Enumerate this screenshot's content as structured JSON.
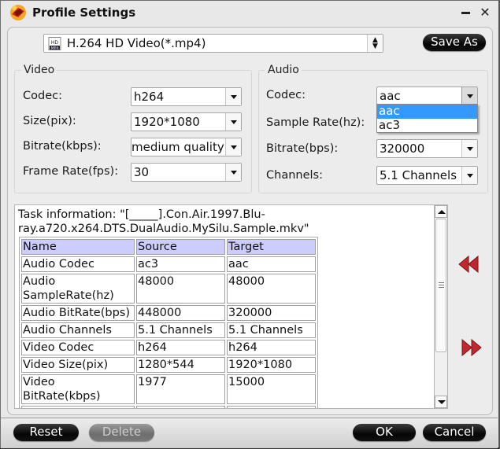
{
  "window": {
    "title": "Profile Settings",
    "minimize_icon": "minimize-icon",
    "close_icon": "close-icon",
    "close_glyph": "✕"
  },
  "format": {
    "selected": "H.264 HD Video(*.mp4)",
    "icon": "mp4-hd-file-icon",
    "save_as_label": "Save As"
  },
  "video": {
    "legend": "Video",
    "fields": [
      {
        "label": "Codec:",
        "value": "h264"
      },
      {
        "label": "Size(pix):",
        "value": "1920*1080"
      },
      {
        "label": "Bitrate(kbps):",
        "value": "medium quality"
      },
      {
        "label": "Frame Rate(fps):",
        "value": "30"
      }
    ]
  },
  "audio": {
    "legend": "Audio",
    "fields": [
      {
        "label": "Codec:",
        "value": "aac"
      },
      {
        "label": "Sample Rate(hz):",
        "value": ""
      },
      {
        "label": "Bitrate(bps):",
        "value": "320000"
      },
      {
        "label": "Channels:",
        "value": "5.1 Channels"
      }
    ],
    "codec_dropdown": {
      "open": true,
      "options": [
        "aac",
        "ac3"
      ],
      "highlighted": "aac"
    }
  },
  "task": {
    "info_text": "Task information: \"[_____].Con.Air.1997.Blu-ray.a720.x264.DTS.DualAudio.MySilu.Sample.mkv\"",
    "columns": [
      "Name",
      "Source",
      "Target"
    ],
    "rows": [
      [
        "Audio Codec",
        "ac3",
        "aac"
      ],
      [
        "Audio SampleRate(hz)",
        "48000",
        "48000"
      ],
      [
        "Audio BitRate(bps)",
        "448000",
        "320000"
      ],
      [
        "Audio Channels",
        "5.1 Channels",
        "5.1 Channels"
      ],
      [
        "Video Codec",
        "h264",
        "h264"
      ],
      [
        "Video Size(pix)",
        "1280*544",
        "1920*1080"
      ],
      [
        "Video BitRate(kbps)",
        "1977",
        "15000"
      ],
      [
        "",
        "",
        ""
      ]
    ]
  },
  "nav": {
    "prev_icon": "rewind-double-arrow-icon",
    "next_icon": "fast-forward-double-arrow-icon",
    "arrow_color": "#c0282d"
  },
  "buttons": {
    "reset": "Reset",
    "delete": "Delete",
    "ok": "OK",
    "cancel": "Cancel"
  },
  "colors": {
    "table_header": "#ccccff",
    "selection": "#3399ff"
  }
}
